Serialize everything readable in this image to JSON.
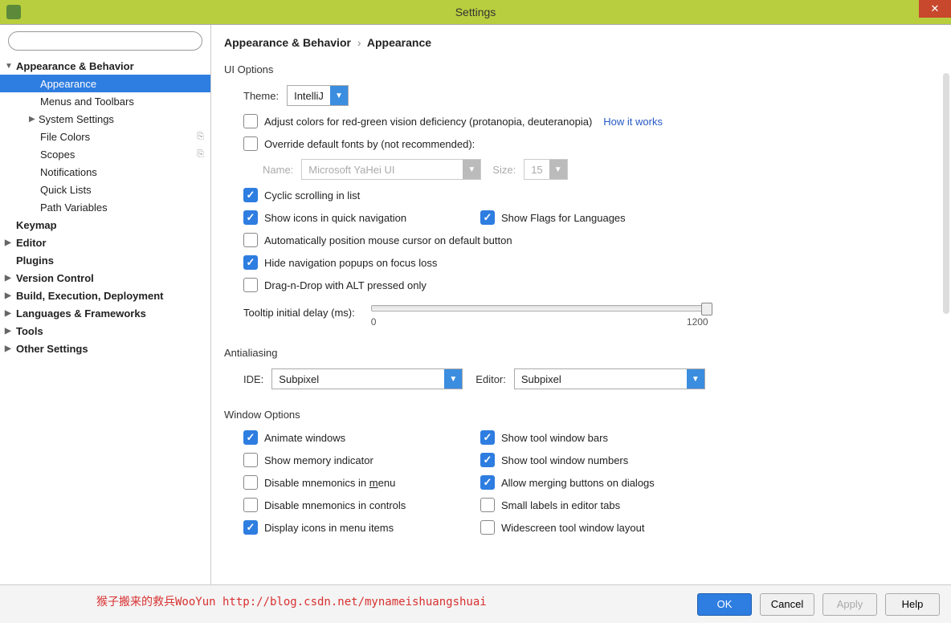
{
  "window": {
    "title": "Settings"
  },
  "sidebar": {
    "search_placeholder": "",
    "items": [
      {
        "label": "Appearance & Behavior",
        "level": 1,
        "expanded": true,
        "arrow": "▼"
      },
      {
        "label": "Appearance",
        "level": 2,
        "selected": true
      },
      {
        "label": "Menus and Toolbars",
        "level": 2
      },
      {
        "label": "System Settings",
        "level": 2,
        "arrow": "▶",
        "has_arrow": true
      },
      {
        "label": "File Colors",
        "level": 2,
        "copy": true
      },
      {
        "label": "Scopes",
        "level": 2,
        "copy": true
      },
      {
        "label": "Notifications",
        "level": 2
      },
      {
        "label": "Quick Lists",
        "level": 2
      },
      {
        "label": "Path Variables",
        "level": 2
      },
      {
        "label": "Keymap",
        "level": 1
      },
      {
        "label": "Editor",
        "level": 1,
        "arrow": "▶"
      },
      {
        "label": "Plugins",
        "level": 1
      },
      {
        "label": "Version Control",
        "level": 1,
        "arrow": "▶"
      },
      {
        "label": "Build, Execution, Deployment",
        "level": 1,
        "arrow": "▶"
      },
      {
        "label": "Languages & Frameworks",
        "level": 1,
        "arrow": "▶"
      },
      {
        "label": "Tools",
        "level": 1,
        "arrow": "▶"
      },
      {
        "label": "Other Settings",
        "level": 1,
        "arrow": "▶"
      }
    ]
  },
  "breadcrumb": {
    "parent": "Appearance & Behavior",
    "sep": "›",
    "current": "Appearance"
  },
  "ui_options": {
    "heading": "UI Options",
    "theme_label": "Theme:",
    "theme_value": "IntelliJ",
    "adjust_colors": "Adjust colors for red-green vision deficiency (protanopia, deuteranopia)",
    "how_it_works": "How it works",
    "override_fonts": "Override default fonts by (not recommended):",
    "name_label": "Name:",
    "name_value": "Microsoft YaHei UI",
    "size_label": "Size:",
    "size_value": "15",
    "cyclic": "Cyclic scrolling in list",
    "show_icons_nav": "Show icons in quick navigation",
    "show_flags": "Show Flags for Languages",
    "auto_cursor": "Automatically position mouse cursor on default button",
    "hide_nav": "Hide navigation popups on focus loss",
    "drag_drop": "Drag-n-Drop with ALT pressed only",
    "tooltip_label": "Tooltip initial delay (ms):",
    "slider_min": "0",
    "slider_max": "1200"
  },
  "antialiasing": {
    "heading": "Antialiasing",
    "ide_label": "IDE:",
    "ide_value": "Subpixel",
    "editor_label": "Editor:",
    "editor_value": "Subpixel"
  },
  "window_options": {
    "heading": "Window Options",
    "animate": "Animate windows",
    "show_memory": "Show memory indicator",
    "disable_mnem_menu": "Disable mnemonics in menu",
    "disable_mnem_ctrl": "Disable mnemonics in controls",
    "display_icons": "Display icons in menu items",
    "show_toolbars": "Show tool window bars",
    "show_numbers": "Show tool window numbers",
    "allow_merging": "Allow merging buttons on dialogs",
    "small_labels": "Small labels in editor tabs",
    "widescreen": "Widescreen tool window layout"
  },
  "footer": {
    "watermark": "猴子搬来的救兵WooYun http://blog.csdn.net/mynameishuangshuai",
    "ok": "OK",
    "cancel": "Cancel",
    "apply": "Apply",
    "help": "Help"
  }
}
